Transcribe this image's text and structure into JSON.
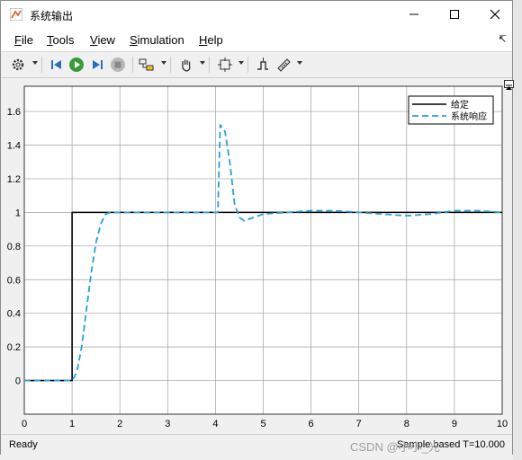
{
  "window": {
    "title": "系统输出"
  },
  "menu": [
    {
      "label": "File",
      "u": "F",
      "rest": "ile"
    },
    {
      "label": "Tools",
      "u": "T",
      "rest": "ools"
    },
    {
      "label": "View",
      "u": "V",
      "rest": "iew"
    },
    {
      "label": "Simulation",
      "u": "S",
      "rest": "imulation"
    },
    {
      "label": "Help",
      "u": "H",
      "rest": "elp"
    }
  ],
  "status": {
    "left": "Ready",
    "right": "Sample based  T=10.000",
    "watermark": "CSDN @小小_光"
  },
  "colors": {
    "reference": "#000000",
    "response": "#2a9fd8",
    "grid": "#a0a0a0"
  },
  "chart_data": {
    "type": "line",
    "title": "",
    "xlabel": "",
    "ylabel": "",
    "xlim": [
      0,
      10
    ],
    "ylim": [
      -0.2,
      1.75
    ],
    "xticks": [
      "0",
      "1",
      "2",
      "3",
      "4",
      "5",
      "6",
      "7",
      "8",
      "9",
      "10"
    ],
    "yticks": [
      "0",
      "0.2",
      "0.4",
      "0.6",
      "0.8",
      "1",
      "1.2",
      "1.4",
      "1.6"
    ],
    "grid": true,
    "legend_position": "top-right",
    "series": [
      {
        "name": "给定",
        "style": "solid",
        "x": [
          0,
          1,
          1,
          10
        ],
        "y": [
          0,
          0,
          1,
          1
        ]
      },
      {
        "name": "系统响应",
        "style": "dashed",
        "x": [
          0,
          1,
          1.1,
          1.2,
          1.3,
          1.4,
          1.5,
          1.6,
          1.7,
          1.8,
          2,
          3,
          4,
          4.05,
          4.1,
          4.2,
          4.3,
          4.4,
          4.5,
          4.6,
          4.8,
          5,
          5.5,
          6,
          6.5,
          7,
          7.5,
          8,
          8.5,
          9,
          9.5,
          10
        ],
        "y": [
          0,
          0,
          0.05,
          0.2,
          0.42,
          0.64,
          0.82,
          0.93,
          0.99,
          1.0,
          1.0,
          1.0,
          1.0,
          1.0,
          1.52,
          1.48,
          1.3,
          1.05,
          0.97,
          0.95,
          0.97,
          0.99,
          1.0,
          1.01,
          1.01,
          1.0,
          0.99,
          0.98,
          0.99,
          1.01,
          1.01,
          1.0
        ]
      }
    ]
  }
}
